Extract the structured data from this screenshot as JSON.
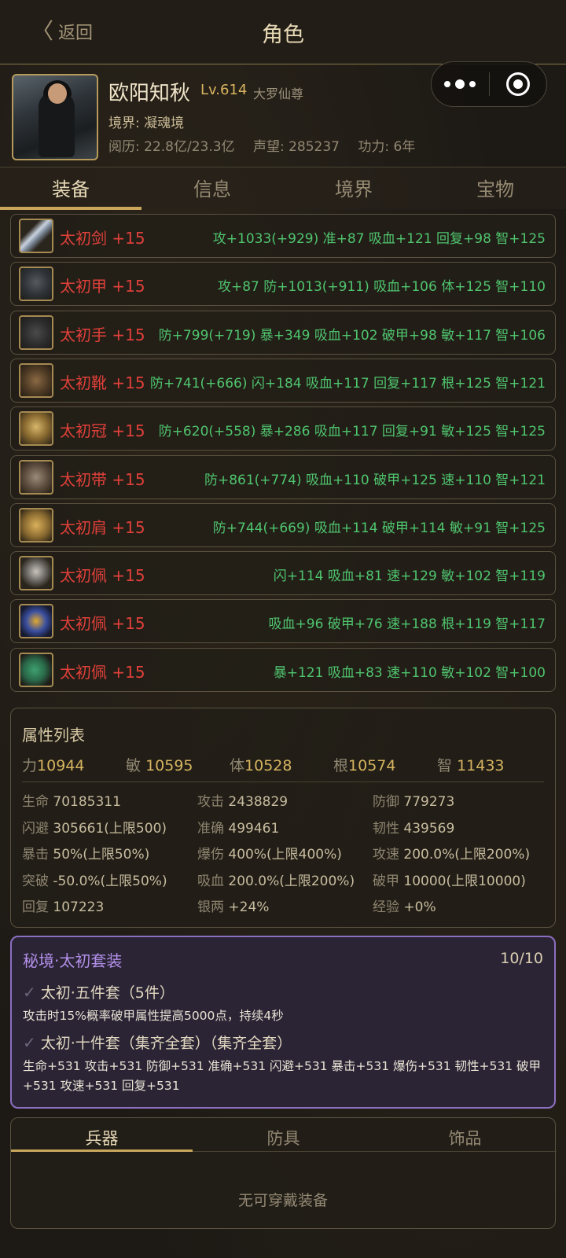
{
  "header": {
    "back_label": "返回",
    "title": "角色"
  },
  "profile": {
    "name": "欧阳知秋",
    "level": "Lv.614",
    "rank": "大罗仙尊",
    "realm": "境界: 凝魂境",
    "experience": "阅历: 22.8亿/23.3亿",
    "reputation": "声望: 285237",
    "power": "功力: 6年"
  },
  "tabs": [
    "装备",
    "信息",
    "境界",
    "宝物"
  ],
  "equipment": [
    {
      "name": "太初剑",
      "enhance": "+15",
      "attrs": "攻+1033(+929) 准+87 吸血+121 回复+98 智+125",
      "icon": "sword-icon"
    },
    {
      "name": "太初甲",
      "enhance": "+15",
      "attrs": "攻+87 防+1013(+911) 吸血+106 体+125 智+110",
      "icon": "armor-icon"
    },
    {
      "name": "太初手",
      "enhance": "+15",
      "attrs": "防+799(+719) 暴+349 吸血+102 破甲+98 敏+117 智+106",
      "icon": "gauntlet-icon"
    },
    {
      "name": "太初靴",
      "enhance": "+15",
      "attrs": "防+741(+666) 闪+184 吸血+117 回复+117 根+125 智+121",
      "icon": "boots-icon"
    },
    {
      "name": "太初冠",
      "enhance": "+15",
      "attrs": "防+620(+558) 暴+286 吸血+117 回复+91 敏+125 智+125",
      "icon": "crown-icon"
    },
    {
      "name": "太初带",
      "enhance": "+15",
      "attrs": "防+861(+774) 吸血+110 破甲+125 速+110 智+121",
      "icon": "belt-icon"
    },
    {
      "name": "太初肩",
      "enhance": "+15",
      "attrs": "防+744(+669) 吸血+114 破甲+114 敏+91 智+125",
      "icon": "shoulder-icon"
    },
    {
      "name": "太初佩",
      "enhance": "+15",
      "attrs": "闪+114 吸血+81 速+129 敏+102 智+119",
      "icon": "amulet-icon"
    },
    {
      "name": "太初佩",
      "enhance": "+15",
      "attrs": "吸血+96 破甲+76 速+188 根+119 智+117",
      "icon": "ring-icon"
    },
    {
      "name": "太初佩",
      "enhance": "+15",
      "attrs": "暴+121 吸血+83 速+110 敏+102 智+100",
      "icon": "jade-icon"
    }
  ],
  "attributes": {
    "title": "属性列表",
    "basics": [
      {
        "label": "力",
        "value": "10944"
      },
      {
        "label": "敏",
        "value": "10595"
      },
      {
        "label": "体",
        "value": "10528"
      },
      {
        "label": "根",
        "value": "10574"
      },
      {
        "label": "智",
        "value": "11433"
      }
    ],
    "stats": [
      {
        "label": "生命",
        "value": "70185311"
      },
      {
        "label": "攻击",
        "value": "2438829"
      },
      {
        "label": "防御",
        "value": "779273"
      },
      {
        "label": "闪避",
        "value": "305661(上限500)"
      },
      {
        "label": "准确",
        "value": "499461"
      },
      {
        "label": "韧性",
        "value": "439569"
      },
      {
        "label": "暴击",
        "value": "50%(上限50%)"
      },
      {
        "label": "爆伤",
        "value": "400%(上限400%)"
      },
      {
        "label": "攻速",
        "value": "200.0%(上限200%)"
      },
      {
        "label": "突破",
        "value": "-50.0%(上限50%)"
      },
      {
        "label": "吸血",
        "value": "200.0%(上限200%)"
      },
      {
        "label": "破甲",
        "value": "10000(上限10000)"
      },
      {
        "label": "回复",
        "value": "107223"
      },
      {
        "label": "银两",
        "value": "+24%"
      },
      {
        "label": "经验",
        "value": "+0%"
      }
    ]
  },
  "set_bonus": {
    "title": "秘境·太初套装",
    "count": "10/10",
    "tier1_title": "太初·五件套（5件）",
    "tier1_desc": "攻击时15%概率破甲属性提高5000点，持续4秒",
    "tier2_title": "太初·十件套（集齐全套）（集齐全套）",
    "tier2_desc": "生命+531 攻击+531 防御+531 准确+531 闪避+531 暴击+531 爆伤+531 韧性+531 破甲+531 攻速+531 回复+531"
  },
  "bottom": {
    "tabs": [
      "兵器",
      "防具",
      "饰品"
    ],
    "empty_text": "无可穿戴装备"
  }
}
